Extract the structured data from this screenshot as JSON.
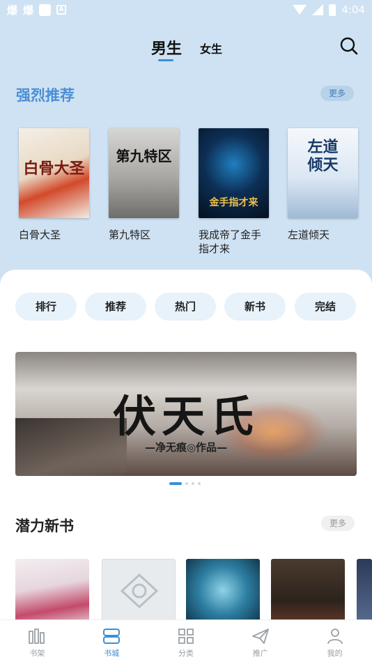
{
  "status_bar": {
    "time": "4:04",
    "glyphs": [
      "爆",
      "爆"
    ],
    "a_icon": "A"
  },
  "top_tabs": [
    {
      "label": "男生",
      "active": true
    },
    {
      "label": "女生",
      "active": false
    }
  ],
  "recommend": {
    "title": "强烈推荐",
    "more": "更多",
    "books": [
      {
        "name": "白骨大圣",
        "cover_text": "白骨大圣"
      },
      {
        "name": "第九特区",
        "cover_text": "第九特区"
      },
      {
        "name": "我成帝了金手指才来",
        "cover_text": "金手指才来"
      },
      {
        "name": "左道倾天",
        "cover_text": "左道倾天"
      }
    ]
  },
  "categories": [
    "排行",
    "推荐",
    "热门",
    "新书",
    "完结"
  ],
  "banner": {
    "title": "伏天氏",
    "subtitle": "—净无痕◎作品—",
    "slides": 4,
    "active_slide": 0
  },
  "new_books": {
    "title": "潜力新书",
    "more": "更多"
  },
  "bottom_nav": [
    {
      "label": "书架",
      "icon": "bookshelf-icon",
      "active": false
    },
    {
      "label": "书城",
      "icon": "bookstore-icon",
      "active": true
    },
    {
      "label": "分类",
      "icon": "category-icon",
      "active": false
    },
    {
      "label": "推广",
      "icon": "promote-icon",
      "active": false
    },
    {
      "label": "我的",
      "icon": "profile-icon",
      "active": false
    }
  ],
  "colors": {
    "accent": "#3a8fd6",
    "header_bg": "#cfe2f3",
    "title_blue": "#4a8fd6"
  }
}
